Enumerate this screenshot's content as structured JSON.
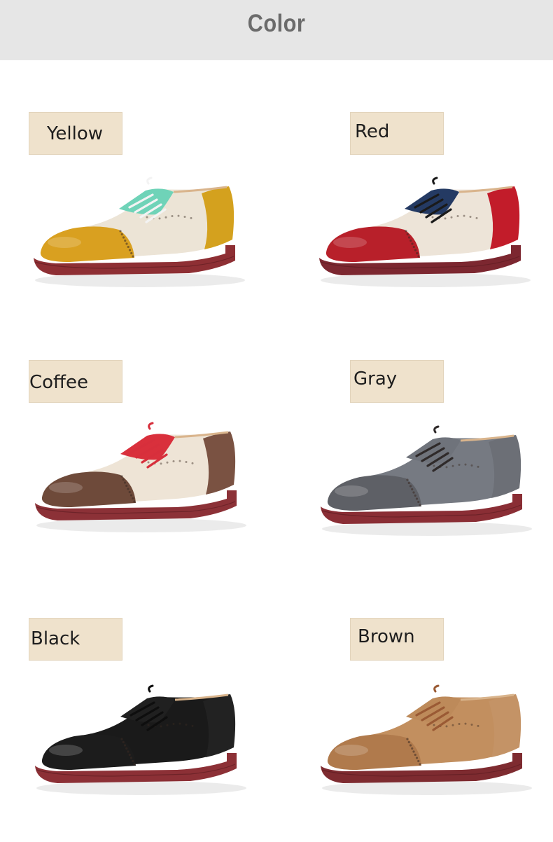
{
  "header": {
    "title": "Color"
  },
  "variants": [
    {
      "label": "Yellow",
      "toe": "#d9a020",
      "heel": "#d4a11e",
      "quarter": "#ece4d6",
      "laceArea": "#6fd3b8",
      "lace": "#f3f3f3",
      "sole": "#8e2f34"
    },
    {
      "label": "Red",
      "toe": "#b8202a",
      "heel": "#c21c2a",
      "quarter": "#ede4d8",
      "laceArea": "#243a63",
      "lace": "#1a1a1a",
      "sole": "#7c2730"
    },
    {
      "label": "Coffee",
      "toe": "#6e4a3a",
      "heel": "#7a5242",
      "quarter": "#eee4d6",
      "laceArea": "#d9303c",
      "lace": "#d72f3c",
      "sole": "#8c3137"
    },
    {
      "label": "Gray",
      "toe": "#5e6066",
      "heel": "#6c6f76",
      "quarter": "#767a82",
      "laceArea": "#6f737b",
      "lace": "#2f2a2a",
      "sole": "#8a2e35"
    },
    {
      "label": "Black",
      "toe": "#1c1c1c",
      "heel": "#222222",
      "quarter": "#1a1a1a",
      "laceArea": "#202020",
      "lace": "#0e0e0e",
      "sole": "#8c3036"
    },
    {
      "label": "Brown",
      "toe": "#b07a4c",
      "heel": "#c49366",
      "quarter": "#c28f5f",
      "laceArea": "#bd8a5a",
      "lace": "#9a5a34",
      "sole": "#7e2b30"
    }
  ]
}
